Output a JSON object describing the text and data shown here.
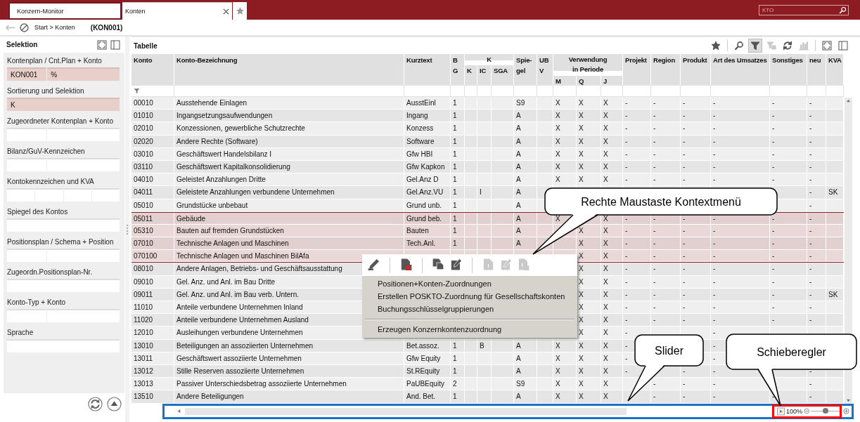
{
  "tabs": [
    {
      "label": "Konzern-Monitor",
      "selected": false,
      "closable": false
    },
    {
      "label": "Konten",
      "selected": true,
      "closable": true
    }
  ],
  "search": {
    "placeholder": "KTO"
  },
  "breadcrumb": {
    "path": "Start > Konten",
    "record": "(KON001)"
  },
  "selection_panel": {
    "title": "Selektion",
    "groups": [
      {
        "label": "Kontenplan / Cnt.Plan + Konto",
        "fields": [
          {
            "filled": true,
            "value": "KON001"
          },
          {
            "filled": true,
            "value": "%"
          }
        ]
      },
      {
        "label": "Sortierung und Selektion",
        "fields": [
          {
            "filled": true,
            "value": "K"
          }
        ]
      },
      {
        "label": "Zugeordneter Kontenplan + Konto",
        "fields": [
          {
            "filled": false
          },
          {
            "filled": false
          }
        ]
      },
      {
        "label": "Bilanz/GuV-Kennzeichen",
        "fields": [
          {
            "filled": false
          },
          {
            "filled": false
          }
        ]
      },
      {
        "label": "Kontokennzeichen und KVA",
        "fields": [
          {
            "filled": false
          },
          {
            "filled": false
          },
          {
            "filled": false
          },
          {
            "filled": false
          }
        ]
      },
      {
        "label": "Spiegel des Kontos",
        "fields": [
          {
            "filled": false
          }
        ]
      },
      {
        "label": "Positionsplan / Schema + Position",
        "fields": [
          {
            "filled": false
          },
          {
            "filled": false
          }
        ]
      },
      {
        "label": "Zugeordn.Positionsplan-Nr.",
        "fields": [
          {
            "filled": false
          }
        ]
      },
      {
        "label": "Konto-Typ + Konto",
        "fields": [
          {
            "filled": false
          },
          {
            "filled": false
          }
        ]
      },
      {
        "label": "Sprache",
        "fields": [
          {
            "filled": false
          }
        ]
      }
    ]
  },
  "table_panel": {
    "title": "Tabelle",
    "toolbar": [
      [
        {
          "kind": "star",
          "disabled": false,
          "on": false
        }
      ],
      [
        {
          "kind": "search",
          "disabled": false,
          "on": false
        },
        {
          "kind": "filter",
          "disabled": false,
          "on": true
        },
        {
          "kind": "filter-clear",
          "disabled": true,
          "on": false
        },
        {
          "kind": "refresh",
          "disabled": false,
          "on": false
        },
        {
          "kind": "chart",
          "disabled": true,
          "on": false
        }
      ],
      [
        {
          "kind": "expand",
          "disabled": false,
          "on": false
        },
        {
          "kind": "panel",
          "disabled": false,
          "on": false
        }
      ]
    ],
    "columns": [
      {
        "lines": [
          "Konto"
        ]
      },
      {
        "lines": [
          "Konto-Bezeichnung"
        ]
      },
      {
        "lines": [
          "Kurztext"
        ]
      },
      {
        "lines": [
          "B",
          "G"
        ]
      },
      {
        "lines": [
          "K"
        ],
        "children": [
          {
            "lines": [
              "K"
            ]
          },
          {
            "lines": [
              "IC"
            ]
          },
          {
            "lines": [
              "SGA"
            ]
          }
        ]
      },
      {
        "lines": [
          "Spie-",
          "gel"
        ]
      },
      {
        "lines": [
          "UB",
          "V"
        ]
      },
      {
        "lines": [
          "Verwendung",
          "in Periode"
        ],
        "children": [
          {
            "lines": [
              "M"
            ]
          },
          {
            "lines": [
              "Q"
            ]
          },
          {
            "lines": [
              "J"
            ]
          }
        ]
      },
      {
        "lines": [
          "Projekt"
        ]
      },
      {
        "lines": [
          "Region"
        ]
      },
      {
        "lines": [
          "Produkt"
        ]
      },
      {
        "lines": [
          "Art des Umsatzes"
        ]
      },
      {
        "lines": [
          "Sonstiges"
        ]
      },
      {
        "lines": [
          "neu"
        ]
      },
      {
        "lines": [
          "KVA"
        ]
      }
    ],
    "rows": [
      {
        "selected": false,
        "cells": {
          "konto": "00010",
          "bezeichnung": "Ausstehende Einlagen",
          "kurztext": "AusstEinl",
          "bg": "1",
          "spiegel": "S9",
          "m": "X",
          "q": "X",
          "j": "X",
          "projekt": "-",
          "region": "-",
          "produkt": "-",
          "art": "-",
          "sonstiges": "-",
          "neu": "-"
        }
      },
      {
        "selected": false,
        "cells": {
          "konto": "01010",
          "bezeichnung": "Ingangsetzungsaufwendungen",
          "kurztext": "Ingang",
          "bg": "1",
          "spiegel": "A",
          "m": "X",
          "q": "X",
          "j": "X",
          "projekt": "-",
          "region": "-",
          "produkt": "-",
          "art": "-",
          "sonstiges": "-",
          "neu": "-"
        }
      },
      {
        "selected": false,
        "cells": {
          "konto": "02010",
          "bezeichnung": "Konzessionen, gewerbliche Schutzrechte",
          "kurztext": "Konzess",
          "bg": "1",
          "spiegel": "A",
          "m": "X",
          "q": "X",
          "j": "X",
          "projekt": "-",
          "region": "-",
          "produkt": "-",
          "art": "-",
          "sonstiges": "-",
          "neu": "-"
        }
      },
      {
        "selected": false,
        "cells": {
          "konto": "02020",
          "bezeichnung": "Andere Rechte (Software)",
          "kurztext": "Software",
          "bg": "1",
          "spiegel": "A",
          "m": "X",
          "q": "X",
          "j": "X",
          "projekt": "-",
          "region": "-",
          "produkt": "-",
          "art": "-",
          "sonstiges": "-",
          "neu": "-"
        }
      },
      {
        "selected": false,
        "cells": {
          "konto": "03010",
          "bezeichnung": "Geschäftswert Handelsbilanz I",
          "kurztext": "Gfw HBI",
          "bg": "1",
          "spiegel": "A",
          "m": "X",
          "q": "X",
          "j": "X",
          "projekt": "-",
          "region": "-",
          "produkt": "-",
          "art": "-",
          "sonstiges": "-",
          "neu": "-"
        }
      },
      {
        "selected": false,
        "cells": {
          "konto": "03110",
          "bezeichnung": "Geschäftswert Kapitalkonsolidierung",
          "kurztext": "Gfw Kapkon",
          "bg": "1",
          "spiegel": "A",
          "m": "X",
          "q": "X",
          "j": "X",
          "projekt": "-",
          "region": "-",
          "produkt": "-",
          "art": "-",
          "sonstiges": "-",
          "neu": "-"
        }
      },
      {
        "selected": false,
        "cells": {
          "konto": "04010",
          "bezeichnung": "Geleistet Anzahlungen Dritte",
          "kurztext": "Gel.Anz D",
          "bg": "1",
          "spiegel": "A",
          "m": "X",
          "q": "X",
          "j": "X",
          "projekt": "-",
          "region": "-",
          "produkt": "-",
          "art": "-",
          "sonstiges": "-",
          "neu": "-"
        }
      },
      {
        "selected": false,
        "cells": {
          "konto": "04011",
          "bezeichnung": "Geleistete Anzahlungen verbundene Unternehmen",
          "kurztext": "Gel.Anz.VU",
          "bg": "1",
          "ic": "I",
          "spiegel": "A",
          "neu": "-",
          "kva": "SK"
        }
      },
      {
        "selected": false,
        "cells": {
          "konto": "05010",
          "bezeichnung": "Grundstücke unbebaut",
          "kurztext": "Grund unb.",
          "bg": "1",
          "spiegel": "A",
          "neu": "-"
        }
      },
      {
        "selected": true,
        "cells": {
          "konto": "05011",
          "bezeichnung": "Gebäude",
          "kurztext": "Grund beb.",
          "bg": "1",
          "spiegel": "A",
          "m": "X",
          "j": "X",
          "projekt": "-",
          "region": "-",
          "produkt": "-",
          "art": "-",
          "sonstiges": "-",
          "neu": "-"
        }
      },
      {
        "selected": true,
        "cells": {
          "konto": "05310",
          "bezeichnung": "Bauten auf fremden Grundstücken",
          "kurztext": "Bauten",
          "bg": "1",
          "spiegel": "A",
          "q": "X",
          "j": "X",
          "projekt": "-",
          "region": "-",
          "produkt": "-",
          "art": "-",
          "sonstiges": "-",
          "neu": "-"
        }
      },
      {
        "selected": true,
        "cells": {
          "konto": "07010",
          "bezeichnung": "Technische Anlagen und Maschinen",
          "kurztext": "Tech.Anl.",
          "bg": "1",
          "spiegel": "A",
          "q": "X",
          "j": "X",
          "projekt": "-",
          "region": "-",
          "produkt": "-",
          "art": "-",
          "sonstiges": "-",
          "neu": "-"
        }
      },
      {
        "selected": true,
        "cells": {
          "konto": "070100",
          "bezeichnung": "Technische Anlagen und Maschinen BilAfa",
          "q": "X",
          "j": "X",
          "projekt": "-",
          "region": "-",
          "produkt": "-",
          "art": "-",
          "sonstiges": "-",
          "neu": "-"
        }
      },
      {
        "selected": false,
        "cells": {
          "konto": "08010",
          "bezeichnung": "Andere Anlagen, Betriebs- und Geschäftsausstattung",
          "q": "X",
          "j": "X",
          "projekt": "-",
          "region": "-",
          "produkt": "-",
          "art": "-",
          "sonstiges": "-",
          "neu": "-"
        }
      },
      {
        "selected": false,
        "cells": {
          "konto": "09010",
          "bezeichnung": "Gel. Anz. und Anl. im Bau Dritte",
          "q": "X",
          "j": "X",
          "projekt": "-",
          "region": "-",
          "produkt": "-",
          "art": "-",
          "sonstiges": "-",
          "neu": "-"
        }
      },
      {
        "selected": false,
        "cells": {
          "konto": "09011",
          "bezeichnung": "Gel. Anz. und Anl. im Bau verb. Untern.",
          "q": "X",
          "j": "X",
          "projekt": "-",
          "region": "-",
          "produkt": "-",
          "art": "-",
          "sonstiges": "-",
          "neu": "-",
          "kva": "SK"
        }
      },
      {
        "selected": false,
        "cells": {
          "konto": "11010",
          "bezeichnung": "Anteile verbundene Unternehmen Inland",
          "q": "X",
          "j": "X",
          "projekt": "-",
          "region": "-",
          "produkt": "-",
          "art": "-",
          "sonstiges": "-",
          "neu": "-"
        }
      },
      {
        "selected": false,
        "cells": {
          "konto": "11020",
          "bezeichnung": "Anteile verbundene Unternehmen Ausland",
          "q": "X",
          "j": "X",
          "projekt": "-",
          "region": "-",
          "produkt": "-",
          "art": "-",
          "sonstiges": "-",
          "neu": "-"
        }
      },
      {
        "selected": false,
        "cells": {
          "konto": "12010",
          "bezeichnung": "Ausleihungen verbundene Unternehmen",
          "q": "X",
          "j": "X",
          "projekt": "-",
          "art": "-"
        }
      },
      {
        "selected": false,
        "cells": {
          "konto": "13010",
          "bezeichnung": "Beteiligungen an assoziierten Unternehmen",
          "kurztext": "Bet.assoz.",
          "bg": "1",
          "ic": "B",
          "spiegel": "A",
          "m": "X",
          "q": "X",
          "j": "X",
          "projekt": "-",
          "art": "-"
        }
      },
      {
        "selected": false,
        "cells": {
          "konto": "13011",
          "bezeichnung": "Geschäftswert assoziierte Unternehmen",
          "kurztext": "Gfw Equity",
          "bg": "1",
          "spiegel": "A",
          "m": "X",
          "q": "X",
          "j": "X",
          "projekt": "-",
          "art": "-"
        }
      },
      {
        "selected": false,
        "cells": {
          "konto": "13012",
          "bezeichnung": "Stille Reserven assoziierte Unternehmen",
          "kurztext": "St.REquity",
          "bg": "1",
          "spiegel": "A",
          "m": "X",
          "q": "X",
          "j": "X",
          "projekt": "-",
          "produkt": "-",
          "art": "-",
          "neu": "-"
        }
      },
      {
        "selected": false,
        "cells": {
          "konto": "13013",
          "bezeichnung": "Passiver Unterschiedsbetrag assoziierte Unternehmen",
          "kurztext": "PaUBEquity",
          "bg": "2",
          "spiegel": "S9",
          "m": "X",
          "q": "X",
          "j": "X",
          "region": "-",
          "produkt": "-",
          "art": "-",
          "neu": "-"
        }
      },
      {
        "selected": false,
        "cells": {
          "konto": "13510",
          "bezeichnung": "Andere Beteiligungen",
          "kurztext": "And. Bet.",
          "bg": "1",
          "spiegel": "A",
          "m": "X",
          "q": "X",
          "j": "X",
          "region": "-",
          "produkt": "-",
          "art": "-",
          "sonstiges": "-",
          "neu": "-"
        }
      }
    ],
    "zoom": {
      "label": "100%",
      "level": 0.5
    }
  },
  "context_menu": {
    "tool_groups": [
      [
        {
          "kind": "pencil",
          "disabled": false
        }
      ],
      [
        {
          "kind": "doc-delete",
          "disabled": false
        }
      ],
      [
        {
          "kind": "copy",
          "disabled": false
        },
        {
          "kind": "doc-edit",
          "disabled": false
        }
      ],
      [
        {
          "kind": "doc-info",
          "disabled": true
        },
        {
          "kind": "doc-edit",
          "disabled": true
        },
        {
          "kind": "doc-info-x",
          "disabled": true
        }
      ]
    ],
    "item_groups": [
      [
        "Positionen+Konten-Zuordnungen",
        "Erstellen POSKTO-Zuordnung für Gesellschaftskonten",
        "Buchungsschlüsselgruppierungen"
      ],
      [
        "Erzeugen Konzernkontenzuordnung"
      ]
    ]
  },
  "annotations": [
    {
      "text": "Rechte Maustaste Kontextmenü"
    },
    {
      "text": "Slider"
    },
    {
      "text": "Schieberegler"
    }
  ],
  "highlight_frames": [
    {
      "color": "#1a73c4"
    },
    {
      "color": "#ff0000"
    }
  ]
}
